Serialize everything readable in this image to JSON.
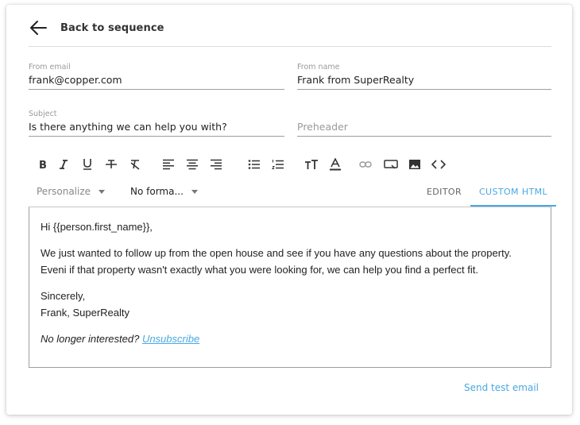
{
  "header": {
    "back_label": "Back to sequence"
  },
  "fields": {
    "from_email": {
      "label": "From email",
      "value": "frank@copper.com"
    },
    "from_name": {
      "label": "From name",
      "value": "Frank from SuperRealty"
    },
    "subject": {
      "label": "Subject",
      "value": "Is there anything we can help you with?"
    },
    "preheader": {
      "placeholder": "Preheader"
    }
  },
  "toolbar": {
    "icons": [
      "bold-icon",
      "italic-icon",
      "underline-icon",
      "strikethrough-icon",
      "clear-format-icon",
      "align-left-icon",
      "align-center-icon",
      "align-right-icon",
      "bullet-list-icon",
      "numbered-list-icon",
      "font-size-icon",
      "text-color-icon",
      "link-icon",
      "button-icon",
      "image-icon",
      "code-icon"
    ],
    "text_color": "#333333"
  },
  "secondary_toolbar": {
    "personalize_label": "Personalize",
    "format_label": "No forma...",
    "tabs": [
      {
        "label": "EDITOR",
        "active": false
      },
      {
        "label": "CUSTOM HTML",
        "active": true
      }
    ]
  },
  "editor": {
    "greeting": "Hi {{person.first_name}},",
    "body_line1": "We just wanted to follow up from the open house and see if you have any questions about the property.",
    "body_line2": "Eveni if that property wasn't exactly what you were looking for, we can help you find a perfect fit.",
    "signoff": "Sincerely,",
    "signature": "Frank, SuperRealty",
    "unsubscribe_prompt": "No longer interested?",
    "unsubscribe_link": "Unsubscribe"
  },
  "footer": {
    "send_test_label": "Send test email"
  },
  "colors": {
    "accent": "#4aa8e0",
    "border": "#9e9e9e",
    "muted": "#9a9a9a"
  }
}
